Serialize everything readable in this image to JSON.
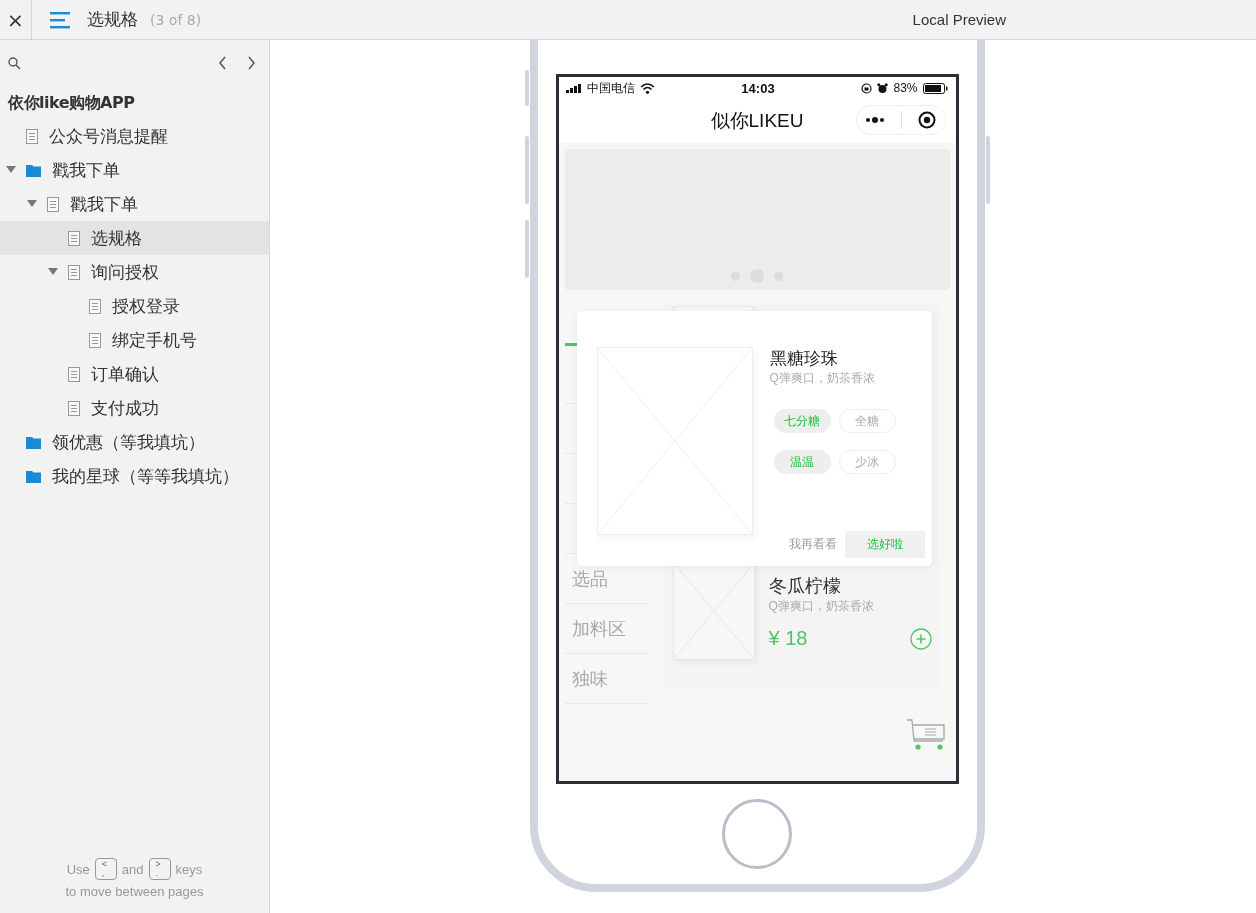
{
  "window": {
    "close": "×",
    "title": "选规格",
    "page_count": "(3 of 8)",
    "preview_label": "Local Preview"
  },
  "sidebar": {
    "project": "依你like购物APP",
    "tree": [
      {
        "kind": "page",
        "label": "公众号消息提醒",
        "selected": false
      },
      {
        "kind": "folder",
        "label": "戳我下单",
        "selected": false,
        "expanded": true,
        "children": [
          {
            "kind": "page",
            "label": "戳我下单",
            "selected": false,
            "expanded": true,
            "children": [
              {
                "kind": "page",
                "label": "选规格",
                "selected": true
              },
              {
                "kind": "page",
                "label": "询问授权",
                "selected": false,
                "expanded": true,
                "children": [
                  {
                    "kind": "page",
                    "label": "授权登录",
                    "selected": false
                  },
                  {
                    "kind": "page",
                    "label": "绑定手机号",
                    "selected": false
                  }
                ]
              },
              {
                "kind": "page",
                "label": "订单确认",
                "selected": false
              },
              {
                "kind": "page",
                "label": "支付成功",
                "selected": false
              }
            ]
          }
        ]
      },
      {
        "kind": "folder",
        "label": "领优惠（等我填坑）",
        "selected": false
      },
      {
        "kind": "folder",
        "label": "我的星球（等等我填坑）",
        "selected": false
      }
    ],
    "hint": {
      "before": "Use",
      "key_prev": {
        "top": "<",
        "bottom": ","
      },
      "middle": "and",
      "key_next": {
        "top": ">",
        "bottom": "."
      },
      "after": "keys",
      "line2": "to move between pages"
    }
  },
  "phone": {
    "status": {
      "carrier": "中国电信",
      "time": "14:03",
      "battery": "83%"
    },
    "nav_title": "似你LIKEU",
    "banner_dots": [
      {
        "selected": false
      },
      {
        "selected": true
      },
      {
        "selected": false
      }
    ],
    "categories": [
      {
        "label": "选品"
      },
      {
        "label": "加料区"
      },
      {
        "label": "独味"
      }
    ],
    "products": [
      {
        "name": "冬瓜柠檬",
        "desc": "Q弹爽口，奶茶香浓",
        "price": "¥ 18"
      }
    ],
    "modal": {
      "name": "黑糖珍珠",
      "desc": "Q弹爽口，奶茶香浓",
      "option_groups": [
        {
          "options": [
            {
              "label": "七分糖",
              "selected": true
            },
            {
              "label": "全糖",
              "selected": false
            }
          ]
        },
        {
          "options": [
            {
              "label": "温温",
              "selected": true
            },
            {
              "label": "少冰",
              "selected": false
            }
          ]
        }
      ],
      "cancel": "我再看看",
      "confirm": "选好啦"
    }
  }
}
